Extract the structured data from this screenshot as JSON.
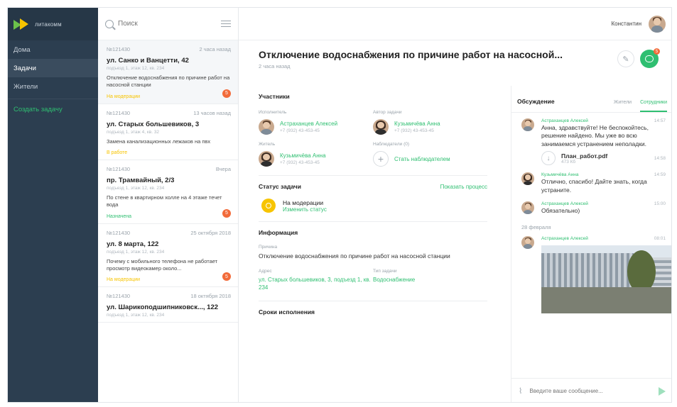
{
  "app": {
    "brand": "литакомм"
  },
  "sidebar": {
    "items": [
      {
        "label": "Дома"
      },
      {
        "label": "Задачи"
      },
      {
        "label": "Жители"
      }
    ],
    "create_label": "Создать задачу"
  },
  "search": {
    "placeholder": "Поиск"
  },
  "tasks": [
    {
      "id": "№121430",
      "time": "2 часа назад",
      "title": "ул. Санко и Ванцетти, 42",
      "sub": "подъезд 1, этаж 12, кв. 234",
      "desc": "Отключение водоснабжения по причине работ на насосной станции",
      "status": "На модерации",
      "status_color": "#f7c400",
      "badge": "5"
    },
    {
      "id": "№121430",
      "time": "13 часов назад",
      "title": "ул. Старых большевиков, 3",
      "sub": "подъезд 1, этаж 4, кв. 32",
      "desc": "Замена канализационных лежаков на пвх",
      "status": "В работе",
      "status_color": "#f7c400",
      "badge": ""
    },
    {
      "id": "№121430",
      "time": "Вчера",
      "title": "пр. Трамвайный, 2/3",
      "sub": "подъезд 1, этаж 12, кв. 234",
      "desc": "По стене в квартирном холле на 4 этаже течет вода",
      "status": "Назначена",
      "status_color": "#2fbf71",
      "badge": "5"
    },
    {
      "id": "№121430",
      "time": "25 октября 2018",
      "title": "ул. 8 марта, 122",
      "sub": "подъезд 1, этаж 12, кв. 234",
      "desc": "Почему с мобильного телефона не работает просмотр видеокамер около...",
      "status": "На модерации",
      "status_color": "#f7c400",
      "badge": "5"
    },
    {
      "id": "№121430",
      "time": "18 октября 2018",
      "title": "ул. Шарикоподшипниковск..., 122",
      "sub": "подъезд 1, этаж 12, кв. 234",
      "desc": "",
      "status": "",
      "status_color": "#f7c400",
      "badge": ""
    }
  ],
  "topbar": {
    "user_name": "Константин"
  },
  "task": {
    "title": "Отключение водоснабжения по причине работ на насосной...",
    "ago": "2 часа назад",
    "edit_icon": "pencil-icon",
    "chat_badge": "5"
  },
  "participants": {
    "title": "Участники",
    "executor_label": "Исполнитель",
    "executor_name": "Астраханцев Алексей",
    "executor_phone": "+7 (932) 43-453-45",
    "author_label": "Автор задачи",
    "author_name": "Кузьмичёва Анна",
    "author_phone": "+7 (932) 43-453-45",
    "resident_label": "Житель",
    "resident_name": "Кузьмичёва Анна",
    "resident_phone": "+7 (932) 43-453-45",
    "observers_label": "Наблюдатели (0)",
    "become_observer": "Стать наблюдателем"
  },
  "status": {
    "title": "Статус задачи",
    "show_process": "Показать процесс",
    "value": "На модерации",
    "change": "Изменить статус"
  },
  "info": {
    "title": "Информация",
    "reason_label": "Причина",
    "reason": "Отключение водоснабжения по причине работ на насосной станции",
    "address_label": "Адрес",
    "address": "ул. Старых большевиков, 3, подъезд 1, кв. 234",
    "type_label": "Тип задачи",
    "type": "Водоснабжение"
  },
  "deadlines": {
    "title": "Сроки исполнения"
  },
  "chat": {
    "title": "Обсуждение",
    "tab_residents": "Жители",
    "tab_staff": "Сотрудники",
    "messages": [
      {
        "author": "Астраханцев Алексей",
        "time": "14:57",
        "text": "Анна, здравствуйте! Не беспокойтесь, решение найдено. Мы уже во всю занимаемся устранением неполадки."
      },
      {
        "author": "Кузьмичёва Анна",
        "time": "14:59",
        "text": "Отлично, спасибо! Дайте знать, когда устраните."
      },
      {
        "author": "Астраханцев Алексей",
        "time": "15:00",
        "text": "Обязательно)"
      },
      {
        "author": "Астраханцев Алексей",
        "time": "08:01",
        "text": ""
      }
    ],
    "file": {
      "name": "План_работ.pdf",
      "size": "473 Кб",
      "time": "14:58"
    },
    "date_separator": "28 февраля",
    "input_placeholder": "Введите ваше сообщение..."
  },
  "colors": {
    "accent": "#2fbf71",
    "sidebar": "#2c3e50",
    "badge": "#f26b3a",
    "status_yellow": "#f7c400"
  }
}
